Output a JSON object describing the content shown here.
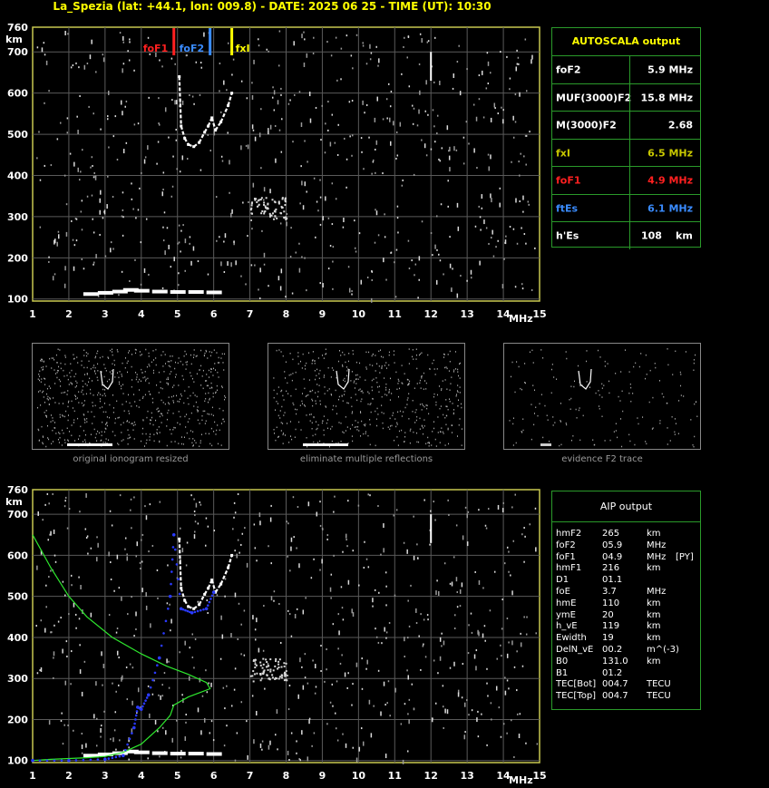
{
  "header": {
    "title": "La_Spezia (lat: +44.1, lon: 009.8) - DATE: 2025 06 25 - TIME (UT): 10:30"
  },
  "ionogram": {
    "y_unit": "km",
    "x_unit": "MHz",
    "y_ticks": [
      "760",
      "700",
      "600",
      "500",
      "400",
      "300",
      "200",
      "100"
    ],
    "x_ticks": [
      "1",
      "2",
      "3",
      "4",
      "5",
      "6",
      "7",
      "8",
      "9",
      "10",
      "11",
      "12",
      "13",
      "14",
      "15"
    ],
    "markers": [
      {
        "label": "foF1",
        "freq": 4.9,
        "color": "#ff2020"
      },
      {
        "label": "foF2",
        "freq": 5.9,
        "color": "#3a8cff"
      },
      {
        "label": "fxI",
        "freq": 6.5,
        "color": "#ffff00"
      }
    ]
  },
  "autoscala": {
    "title": "AUTOSCALA output",
    "rows": [
      {
        "label": "foF2",
        "value": "5.9 MHz",
        "color": "#ffffff"
      },
      {
        "label": "MUF(3000)F2",
        "value": "15.8 MHz",
        "color": "#ffffff"
      },
      {
        "label": "M(3000)F2",
        "value": "2.68",
        "color": "#ffffff"
      },
      {
        "label": "fxI",
        "value": "6.5 MHz",
        "color": "#c8c800"
      },
      {
        "label": "foF1",
        "value": "4.9 MHz",
        "color": "#ff2020"
      },
      {
        "label": "ftEs",
        "value": "6.1 MHz",
        "color": "#3a8cff"
      }
    ],
    "hes": {
      "label": "h'Es",
      "value": "108",
      "unit": "km"
    }
  },
  "thumbnails": [
    {
      "caption": "original ionogram resized"
    },
    {
      "caption": "eliminate multiple reflections"
    },
    {
      "caption": "evidence F2 trace"
    }
  ],
  "aip": {
    "title": "AIP output",
    "rows": [
      {
        "name": "hmF2",
        "val": "265",
        "unit": "km",
        "extra": ""
      },
      {
        "name": "foF2",
        "val": "05.9",
        "unit": "MHz",
        "extra": ""
      },
      {
        "name": "foF1",
        "val": "04.9",
        "unit": "MHz",
        "extra": "[PY]"
      },
      {
        "name": "hmF1",
        "val": "216",
        "unit": "km",
        "extra": ""
      },
      {
        "name": "D1",
        "val": "01.1",
        "unit": "",
        "extra": ""
      },
      {
        "name": "foE",
        "val": "3.7",
        "unit": "MHz",
        "extra": ""
      },
      {
        "name": "hmE",
        "val": "110",
        "unit": "km",
        "extra": ""
      },
      {
        "name": "ymE",
        "val": "20",
        "unit": "km",
        "extra": ""
      },
      {
        "name": "h_vE",
        "val": "119",
        "unit": "km",
        "extra": ""
      },
      {
        "name": "Ewidth",
        "val": "19",
        "unit": "km",
        "extra": ""
      },
      {
        "name": "DelN_vE",
        "val": "00.2",
        "unit": "m^(-3)",
        "extra": ""
      },
      {
        "name": "B0",
        "val": "131.0",
        "unit": "km",
        "extra": ""
      },
      {
        "name": "B1",
        "val": "01.2",
        "unit": "",
        "extra": ""
      },
      {
        "name": "TEC[Bot]",
        "val": "004.7",
        "unit": "TECU",
        "extra": ""
      },
      {
        "name": "TEC[Top]",
        "val": "004.7",
        "unit": "TECU",
        "extra": ""
      }
    ]
  },
  "chart_data": [
    {
      "type": "scatter",
      "title": "La_Spezia (lat: +44.1, lon: 009.8) - DATE: 2025 06 25 - TIME (UT): 10:30",
      "xlabel": "MHz",
      "ylabel": "km",
      "xlim": [
        1,
        15
      ],
      "ylim": [
        95,
        760
      ],
      "grid": true,
      "series": [
        {
          "name": "F2 trace",
          "x": [
            5.05,
            5.1,
            5.2,
            5.3,
            5.45,
            5.6,
            5.75,
            5.85,
            5.95,
            6.05,
            6.2,
            6.4,
            6.5
          ],
          "y": [
            640,
            520,
            490,
            475,
            470,
            480,
            505,
            520,
            540,
            510,
            530,
            570,
            600
          ]
        },
        {
          "name": "Es trace",
          "x": [
            2.6,
            3.0,
            3.4,
            3.7,
            4.0,
            4.5,
            5.0,
            5.5,
            6.0
          ],
          "y": [
            112,
            115,
            118,
            122,
            120,
            118,
            117,
            117,
            116
          ]
        }
      ]
    },
    {
      "type": "line",
      "xlim": [
        1,
        15
      ],
      "ylim": [
        95,
        760
      ],
      "series": [
        {
          "name": "Electron density profile",
          "x": [
            1.0,
            1.5,
            2.0,
            2.5,
            3.0,
            3.5,
            4.0,
            4.5,
            4.8,
            4.9,
            5.3,
            5.9,
            5.8,
            5.3,
            4.7,
            4.0,
            3.2,
            2.5,
            2.0,
            1.5,
            1.0
          ],
          "y": [
            100,
            103,
            105,
            107,
            110,
            120,
            140,
            180,
            210,
            235,
            255,
            275,
            290,
            310,
            330,
            360,
            400,
            450,
            500,
            570,
            650
          ]
        },
        {
          "name": "True height profile",
          "x": [
            1.0,
            2.0,
            3.0,
            3.5,
            3.8,
            3.9,
            4.0,
            4.2,
            4.5,
            4.8,
            4.9,
            5.1,
            5.4,
            5.8,
            6.0
          ],
          "y": [
            100,
            100,
            103,
            112,
            180,
            230,
            225,
            260,
            350,
            500,
            650,
            470,
            460,
            470,
            510
          ]
        }
      ]
    }
  ]
}
